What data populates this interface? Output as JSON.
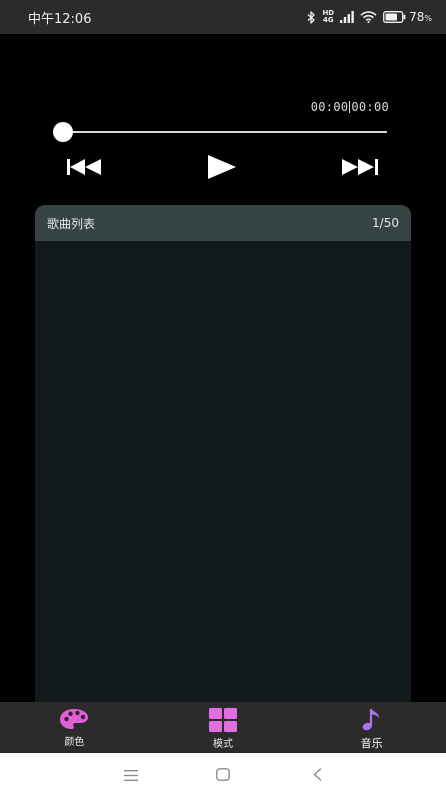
{
  "status_bar": {
    "time": "中午12:06",
    "network_line1": "HD",
    "network_line2": "4G",
    "battery_value": "78",
    "battery_unit": "%",
    "icons": [
      "bluetooth-icon",
      "cell-signal-icon",
      "wifi-icon",
      "battery-icon"
    ]
  },
  "player": {
    "elapsed": "00:00",
    "duration": "00:00",
    "progress": 0.0,
    "controls": [
      "previous-track-icon",
      "play-icon",
      "next-track-icon"
    ]
  },
  "playlist": {
    "title": "歌曲列表",
    "count": "1/50"
  },
  "bottom_nav": {
    "items": [
      {
        "label": "颜色",
        "icon": "palette-icon"
      },
      {
        "label": "模式",
        "icon": "grid-mode-icon"
      },
      {
        "label": "音乐",
        "icon": "music-note-icon"
      }
    ],
    "active_index": 2
  },
  "system_nav": {
    "icons": [
      "menu-icon",
      "home-icon",
      "back-icon"
    ]
  },
  "colors": {
    "accent_pink": "#e060d8",
    "accent_purple": "#b070f0",
    "playlist_header": "#364443",
    "playlist_body": "#121a1b",
    "bar_background": "#2b2b2b"
  }
}
